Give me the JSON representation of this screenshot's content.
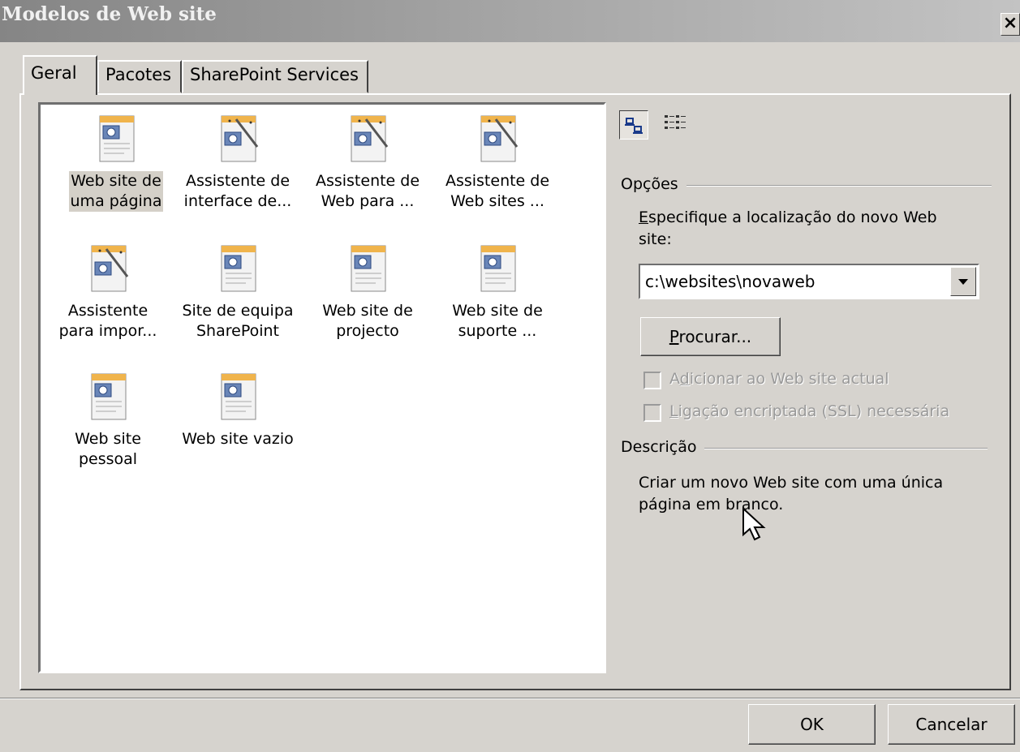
{
  "window": {
    "title": "Modelos de Web site",
    "close_glyph": "×"
  },
  "tabs": [
    {
      "label": "Geral",
      "active": true
    },
    {
      "label": "Pacotes",
      "active": false
    },
    {
      "label": "SharePoint Services",
      "active": false
    }
  ],
  "templates": [
    {
      "label": "Web site de\numa página",
      "icon": "page-icon",
      "selected": true
    },
    {
      "label": "Assistente de\ninterface de...",
      "icon": "wizard-icon"
    },
    {
      "label": "Assistente de\nWeb para ...",
      "icon": "wizard-icon"
    },
    {
      "label": "Assistente de\nWeb sites ...",
      "icon": "wizard-icon"
    },
    {
      "label": "Assistente\npara impor...",
      "icon": "wizard-icon"
    },
    {
      "label": "Site de equipa\nSharePoint",
      "icon": "page-icon"
    },
    {
      "label": "Web site de\nprojecto",
      "icon": "page-icon"
    },
    {
      "label": "Web site de\nsuporte ...",
      "icon": "page-icon"
    },
    {
      "label": "Web site\npessoal",
      "icon": "page-icon"
    },
    {
      "label": "Web site vazio",
      "icon": "page-icon"
    }
  ],
  "options": {
    "group_label": "Opções",
    "location_label_first": "E",
    "location_label_rest": "specifique a localização do novo Web",
    "location_label_line2": "site:",
    "location_value": "c:\\websites\\novaweb",
    "browse_first": "P",
    "browse_rest": "rocurar...",
    "add_current_a": "A",
    "add_current_u": "d",
    "add_current_rest": "icionar ao Web site actual",
    "ssl_u": "L",
    "ssl_rest": "igação encriptada (SSL) necessária"
  },
  "description": {
    "group_label": "Descrição",
    "line1": "Criar um novo Web site com uma única",
    "line2": "página em branco."
  },
  "buttons": {
    "ok": "OK",
    "cancel": "Cancelar"
  },
  "colors": {
    "face": "#d6d3ce",
    "title_start": "#858585",
    "title_end": "#c3c3c3"
  }
}
